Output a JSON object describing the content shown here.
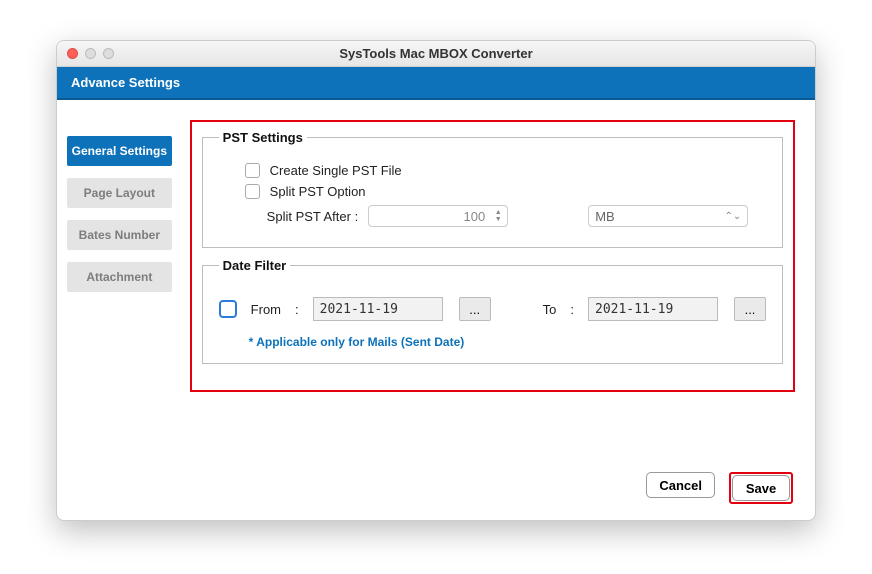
{
  "window": {
    "title": "SysTools Mac MBOX Converter"
  },
  "header": {
    "title": "Advance Settings"
  },
  "sidebar": {
    "items": [
      {
        "label": "General Settings",
        "active": true
      },
      {
        "label": "Page Layout",
        "active": false
      },
      {
        "label": "Bates Number",
        "active": false
      },
      {
        "label": "Attachment",
        "active": false
      }
    ]
  },
  "pst": {
    "legend": "PST Settings",
    "create_label": "Create Single PST File",
    "split_label": "Split PST Option",
    "split_after_label": "Split PST After :",
    "split_value": "100",
    "unit_selected": "MB"
  },
  "datefilter": {
    "legend": "Date Filter",
    "from_label": "From",
    "to_label": "To",
    "colon": ":",
    "from_value": "2021-11-19",
    "to_value": "2021-11-19",
    "ellipsis": "...",
    "note": "* Applicable only for Mails (Sent Date)"
  },
  "footer": {
    "cancel": "Cancel",
    "save": "Save"
  }
}
